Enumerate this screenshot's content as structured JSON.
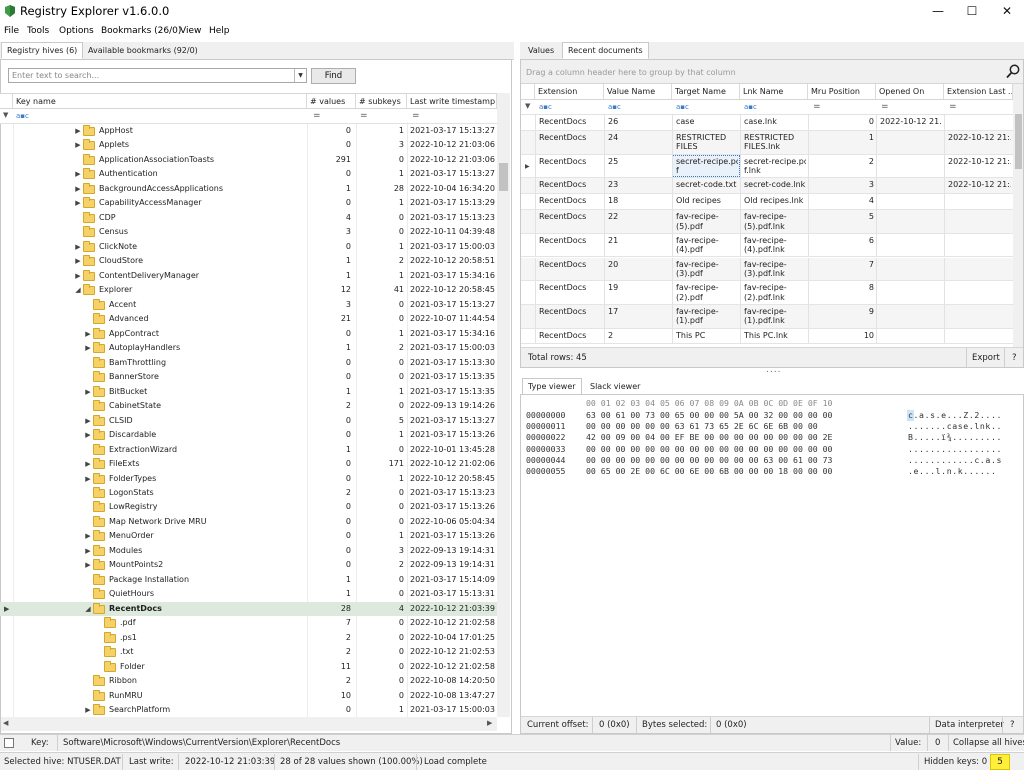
{
  "title": "Registry Explorer v1.6.0.0",
  "menu": [
    "File",
    "Tools",
    "Options",
    "Bookmarks (26/0)",
    "View",
    "Help"
  ],
  "left_tabs": {
    "hives": "Registry hives (6)",
    "bookmarks": "Available bookmarks (92/0)"
  },
  "search": {
    "placeholder": "Enter text to search...",
    "find": "Find"
  },
  "tree_cols": {
    "key": "Key name",
    "values": "# values",
    "subkeys": "# subkeys",
    "ts": "Last write timestamp"
  },
  "tree_rows": [
    {
      "name": "AppHost",
      "v": "0",
      "s": "1",
      "t": "2021-03-17 15:13:27",
      "lvl": 0,
      "exp": true
    },
    {
      "name": "Applets",
      "v": "0",
      "s": "3",
      "t": "2022-10-12 21:03:06",
      "lvl": 0,
      "exp": true
    },
    {
      "name": "ApplicationAssociationToasts",
      "v": "291",
      "s": "0",
      "t": "2022-10-12 21:03:06",
      "lvl": 0,
      "exp": false
    },
    {
      "name": "Authentication",
      "v": "0",
      "s": "1",
      "t": "2021-03-17 15:13:27",
      "lvl": 0,
      "exp": true
    },
    {
      "name": "BackgroundAccessApplications",
      "v": "1",
      "s": "28",
      "t": "2022-10-04 16:34:20",
      "lvl": 0,
      "exp": true
    },
    {
      "name": "CapabilityAccessManager",
      "v": "0",
      "s": "1",
      "t": "2021-03-17 15:13:29",
      "lvl": 0,
      "exp": true
    },
    {
      "name": "CDP",
      "v": "4",
      "s": "0",
      "t": "2021-03-17 15:13:23",
      "lvl": 0,
      "exp": false
    },
    {
      "name": "Census",
      "v": "3",
      "s": "0",
      "t": "2022-10-11 04:39:48",
      "lvl": 0,
      "exp": false
    },
    {
      "name": "ClickNote",
      "v": "0",
      "s": "1",
      "t": "2021-03-17 15:00:03",
      "lvl": 0,
      "exp": true
    },
    {
      "name": "CloudStore",
      "v": "1",
      "s": "2",
      "t": "2022-10-12 20:58:51",
      "lvl": 0,
      "exp": true
    },
    {
      "name": "ContentDeliveryManager",
      "v": "1",
      "s": "1",
      "t": "2021-03-17 15:34:16",
      "lvl": 0,
      "exp": true
    },
    {
      "name": "Explorer",
      "v": "12",
      "s": "41",
      "t": "2022-10-12 20:58:45",
      "lvl": 0,
      "exp": true,
      "open": true
    },
    {
      "name": "Accent",
      "v": "3",
      "s": "0",
      "t": "2021-03-17 15:13:27",
      "lvl": 1,
      "exp": false
    },
    {
      "name": "Advanced",
      "v": "21",
      "s": "0",
      "t": "2022-10-07 11:44:54",
      "lvl": 1,
      "exp": false
    },
    {
      "name": "AppContract",
      "v": "0",
      "s": "1",
      "t": "2021-03-17 15:34:16",
      "lvl": 1,
      "exp": true
    },
    {
      "name": "AutoplayHandlers",
      "v": "1",
      "s": "2",
      "t": "2021-03-17 15:00:03",
      "lvl": 1,
      "exp": true
    },
    {
      "name": "BamThrottling",
      "v": "0",
      "s": "0",
      "t": "2021-03-17 15:13:30",
      "lvl": 1,
      "exp": false
    },
    {
      "name": "BannerStore",
      "v": "0",
      "s": "0",
      "t": "2021-03-17 15:13:35",
      "lvl": 1,
      "exp": false
    },
    {
      "name": "BitBucket",
      "v": "1",
      "s": "1",
      "t": "2021-03-17 15:13:35",
      "lvl": 1,
      "exp": true
    },
    {
      "name": "CabinetState",
      "v": "2",
      "s": "0",
      "t": "2022-09-13 19:14:26",
      "lvl": 1,
      "exp": false
    },
    {
      "name": "CLSID",
      "v": "0",
      "s": "5",
      "t": "2021-03-17 15:13:27",
      "lvl": 1,
      "exp": true
    },
    {
      "name": "Discardable",
      "v": "0",
      "s": "1",
      "t": "2021-03-17 15:13:26",
      "lvl": 1,
      "exp": true
    },
    {
      "name": "ExtractionWizard",
      "v": "1",
      "s": "0",
      "t": "2022-10-01 13:45:28",
      "lvl": 1,
      "exp": false
    },
    {
      "name": "FileExts",
      "v": "0",
      "s": "171",
      "t": "2022-10-12 21:02:06",
      "lvl": 1,
      "exp": true
    },
    {
      "name": "FolderTypes",
      "v": "0",
      "s": "1",
      "t": "2022-10-12 20:58:45",
      "lvl": 1,
      "exp": true
    },
    {
      "name": "LogonStats",
      "v": "2",
      "s": "0",
      "t": "2021-03-17 15:13:23",
      "lvl": 1,
      "exp": false
    },
    {
      "name": "LowRegistry",
      "v": "0",
      "s": "0",
      "t": "2021-03-17 15:13:26",
      "lvl": 1,
      "exp": false
    },
    {
      "name": "Map Network Drive MRU",
      "v": "0",
      "s": "0",
      "t": "2022-10-06 05:04:34",
      "lvl": 1,
      "exp": false
    },
    {
      "name": "MenuOrder",
      "v": "0",
      "s": "1",
      "t": "2021-03-17 15:13:26",
      "lvl": 1,
      "exp": true
    },
    {
      "name": "Modules",
      "v": "0",
      "s": "3",
      "t": "2022-09-13 19:14:31",
      "lvl": 1,
      "exp": true
    },
    {
      "name": "MountPoints2",
      "v": "0",
      "s": "2",
      "t": "2022-09-13 19:14:31",
      "lvl": 1,
      "exp": true
    },
    {
      "name": "Package Installation",
      "v": "1",
      "s": "0",
      "t": "2021-03-17 15:14:09",
      "lvl": 1,
      "exp": false
    },
    {
      "name": "QuietHours",
      "v": "1",
      "s": "0",
      "t": "2021-03-17 15:13:31",
      "lvl": 1,
      "exp": false
    },
    {
      "name": "RecentDocs",
      "v": "28",
      "s": "4",
      "t": "2022-10-12 21:03:39",
      "lvl": 1,
      "exp": true,
      "open": true,
      "sel": true
    },
    {
      "name": ".pdf",
      "v": "7",
      "s": "0",
      "t": "2022-10-12 21:02:58",
      "lvl": 2,
      "exp": false
    },
    {
      "name": ".ps1",
      "v": "2",
      "s": "0",
      "t": "2022-10-04 17:01:25",
      "lvl": 2,
      "exp": false
    },
    {
      "name": ".txt",
      "v": "2",
      "s": "0",
      "t": "2022-10-12 21:02:53",
      "lvl": 2,
      "exp": false
    },
    {
      "name": "Folder",
      "v": "11",
      "s": "0",
      "t": "2022-10-12 21:02:58",
      "lvl": 2,
      "exp": false
    },
    {
      "name": "Ribbon",
      "v": "2",
      "s": "0",
      "t": "2022-10-08 14:20:50",
      "lvl": 1,
      "exp": false
    },
    {
      "name": "RunMRU",
      "v": "10",
      "s": "0",
      "t": "2022-10-08 13:47:27",
      "lvl": 1,
      "exp": false
    },
    {
      "name": "SearchPlatform",
      "v": "0",
      "s": "1",
      "t": "2021-03-17 15:00:03",
      "lvl": 1,
      "exp": true
    }
  ],
  "right_tabs": {
    "values": "Values",
    "recent": "Recent documents"
  },
  "group_hint": "Drag a column header here to group by that column",
  "data_cols": [
    "Extension",
    "Value Name",
    "Target Name",
    "Lnk Name",
    "Mru Position",
    "Opened On",
    "Extension Last ..."
  ],
  "data_rows": [
    {
      "ext": "RecentDocs",
      "vn": "26",
      "tn": "case",
      "ln": "case.lnk",
      "mru": "0",
      "oo": "2022-10-12 21...",
      "el": ""
    },
    {
      "ext": "RecentDocs",
      "vn": "24",
      "tn": "RESTRICTED\nFILES",
      "ln": "RESTRICTED\nFILES.lnk",
      "mru": "1",
      "oo": "",
      "el": "2022-10-12 21:..."
    },
    {
      "ext": "RecentDocs",
      "vn": "25",
      "tn": "secret-recipe.pd\nf",
      "ln": "secret-recipe.pd\nf.lnk",
      "mru": "2",
      "oo": "",
      "el": "2022-10-12 21:..."
    },
    {
      "ext": "RecentDocs",
      "vn": "23",
      "tn": "secret-code.txt",
      "ln": "secret-code.lnk",
      "mru": "3",
      "oo": "",
      "el": "2022-10-12 21:..."
    },
    {
      "ext": "RecentDocs",
      "vn": "18",
      "tn": "Old recipes",
      "ln": "Old recipes.lnk",
      "mru": "4",
      "oo": "",
      "el": ""
    },
    {
      "ext": "RecentDocs",
      "vn": "22",
      "tn": "fav-recipe-\n(5).pdf",
      "ln": "fav-recipe-\n(5).pdf.lnk",
      "mru": "5",
      "oo": "",
      "el": ""
    },
    {
      "ext": "RecentDocs",
      "vn": "21",
      "tn": "fav-recipe-\n(4).pdf",
      "ln": "fav-recipe-\n(4).pdf.lnk",
      "mru": "6",
      "oo": "",
      "el": ""
    },
    {
      "ext": "RecentDocs",
      "vn": "20",
      "tn": "fav-recipe-\n(3).pdf",
      "ln": "fav-recipe-\n(3).pdf.lnk",
      "mru": "7",
      "oo": "",
      "el": ""
    },
    {
      "ext": "RecentDocs",
      "vn": "19",
      "tn": "fav-recipe-\n(2).pdf",
      "ln": "fav-recipe-\n(2).pdf.lnk",
      "mru": "8",
      "oo": "",
      "el": ""
    },
    {
      "ext": "RecentDocs",
      "vn": "17",
      "tn": "fav-recipe-\n(1).pdf",
      "ln": "fav-recipe-\n(1).pdf.lnk",
      "mru": "9",
      "oo": "",
      "el": ""
    },
    {
      "ext": "RecentDocs",
      "vn": "2",
      "tn": "This PC",
      "ln": "This PC.lnk",
      "mru": "10",
      "oo": "",
      "el": ""
    }
  ],
  "total_rows": "Total rows: 45",
  "export": "Export",
  "help": "?",
  "viewer_tabs": {
    "type": "Type viewer",
    "slack": "Slack viewer"
  },
  "hex_header": "00 01 02 03 04 05 06 07 08 09 0A 0B 0C 0D 0E 0F 10",
  "hex_rows": [
    {
      "off": "00000000",
      "bytes": "63 00 61 00 73 00 65 00 00 00 5A 00 32 00 00 00 00",
      "ascii": "c.a.s.e...Z.2...."
    },
    {
      "off": "00000011",
      "bytes": "00 00 00 00 00 00 63 61 73 65 2E 6C 6E 6B 00 00",
      "ascii": ".......case.lnk.."
    },
    {
      "off": "00000022",
      "bytes": "42 00 09 00 04 00 EF BE 00 00 00 00 00 00 00 00 2E",
      "ascii": "B.....ï¾........."
    },
    {
      "off": "00000033",
      "bytes": "00 00 00 00 00 00 00 00 00 00 00 00 00 00 00 00 00",
      "ascii": "................."
    },
    {
      "off": "00000044",
      "bytes": "00 00 00 00 00 00 00 00 00 00 00 00 63 00 61 00 73",
      "ascii": "............c.a.s"
    },
    {
      "off": "00000055",
      "bytes": "00 65 00 2E 00 6C 00 6E 00 6B 00 00 00 18 00 00 00",
      "ascii": ".e...l.n.k......"
    }
  ],
  "hex_status": {
    "offset_label": "Current offset:",
    "offset": "0 (0x0)",
    "bytes_label": "Bytes selected:",
    "bytes": "0 (0x0)",
    "interp": "Data interpreter",
    "help": "?"
  },
  "keybar": {
    "key_label": "Key:",
    "key": "Software\\Microsoft\\Windows\\CurrentVersion\\Explorer\\RecentDocs",
    "value_label": "Value:",
    "value": "0",
    "collapse": "Collapse all hives"
  },
  "status": {
    "hive": "Selected hive: NTUSER.DAT",
    "lastwrite": "Last write:",
    "lastwrite_val": "2022-10-12 21:03:39",
    "shown": "28 of 28 values shown (100.00%)",
    "load": "Load complete",
    "hidden": "Hidden keys: 0",
    "badge": "5"
  },
  "colors": {
    "accent": "#4e9a47",
    "selection": "#dde9dd",
    "folder": "#f5d167",
    "badge": "#ffef3a"
  }
}
